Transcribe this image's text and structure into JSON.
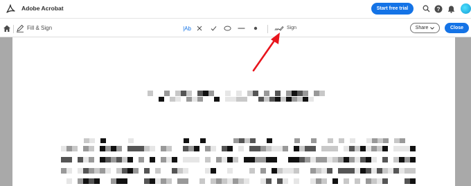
{
  "app": {
    "title": "Adobe Acrobat",
    "trial_label": "Start free trial"
  },
  "top_icons": [
    "search-icon",
    "help-icon",
    "bell-icon",
    "avatar"
  ],
  "toolbar": {
    "mode_label": "Fill & Sign",
    "text_tool_label": "|Ab",
    "sign_label": "Sign",
    "share_label": "Share",
    "close_label": "Close"
  },
  "tools": [
    "text-tool",
    "cross-mark-tool",
    "check-mark-tool",
    "ellipse-tool",
    "line-tool",
    "dot-tool",
    "sign-tool"
  ],
  "colors": {
    "accent": "#1473e6",
    "annotation_arrow": "#e8141c",
    "gutter": "#a9a9a9"
  },
  "document": {
    "content": "pixelated / redacted text"
  }
}
